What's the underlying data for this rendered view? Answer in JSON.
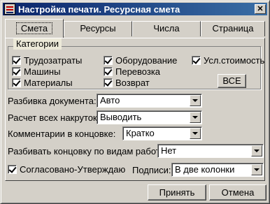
{
  "window": {
    "title": "Настройка печати. Ресурсная смета",
    "close_glyph": "✕"
  },
  "tabs": [
    {
      "label": "Смета",
      "active": true
    },
    {
      "label": "Ресурсы",
      "active": false
    },
    {
      "label": "Числа",
      "active": false
    },
    {
      "label": "Страница",
      "active": false
    }
  ],
  "categories": {
    "label": "Категории",
    "items": [
      {
        "label": "Трудозатраты",
        "checked": true
      },
      {
        "label": "Машины",
        "checked": true
      },
      {
        "label": "Материалы",
        "checked": true
      },
      {
        "label": "Оборудование",
        "checked": true
      },
      {
        "label": "Перевозка",
        "checked": true
      },
      {
        "label": "Возврат",
        "checked": true
      },
      {
        "label": "Усл.стоимость",
        "checked": true
      }
    ],
    "all_button": "ВСЕ"
  },
  "fields": {
    "doc_split": {
      "label": "Разбивка документа:",
      "value": "Авто"
    },
    "markup_calc": {
      "label": "Расчет всех накруток:",
      "value": "Выводить"
    },
    "comments": {
      "label": "Комментарии в концовке:",
      "value": "Кратко"
    },
    "ending_split": {
      "label": "Разбивать концовку по видам работ:",
      "value": "Нет"
    },
    "signatures": {
      "label": "Подписи:",
      "value": "В две колонки"
    }
  },
  "approve": {
    "label": "Согласовано-Утверждаю",
    "checked": true
  },
  "footer": {
    "accept": "Принять",
    "cancel": "Отмена"
  }
}
